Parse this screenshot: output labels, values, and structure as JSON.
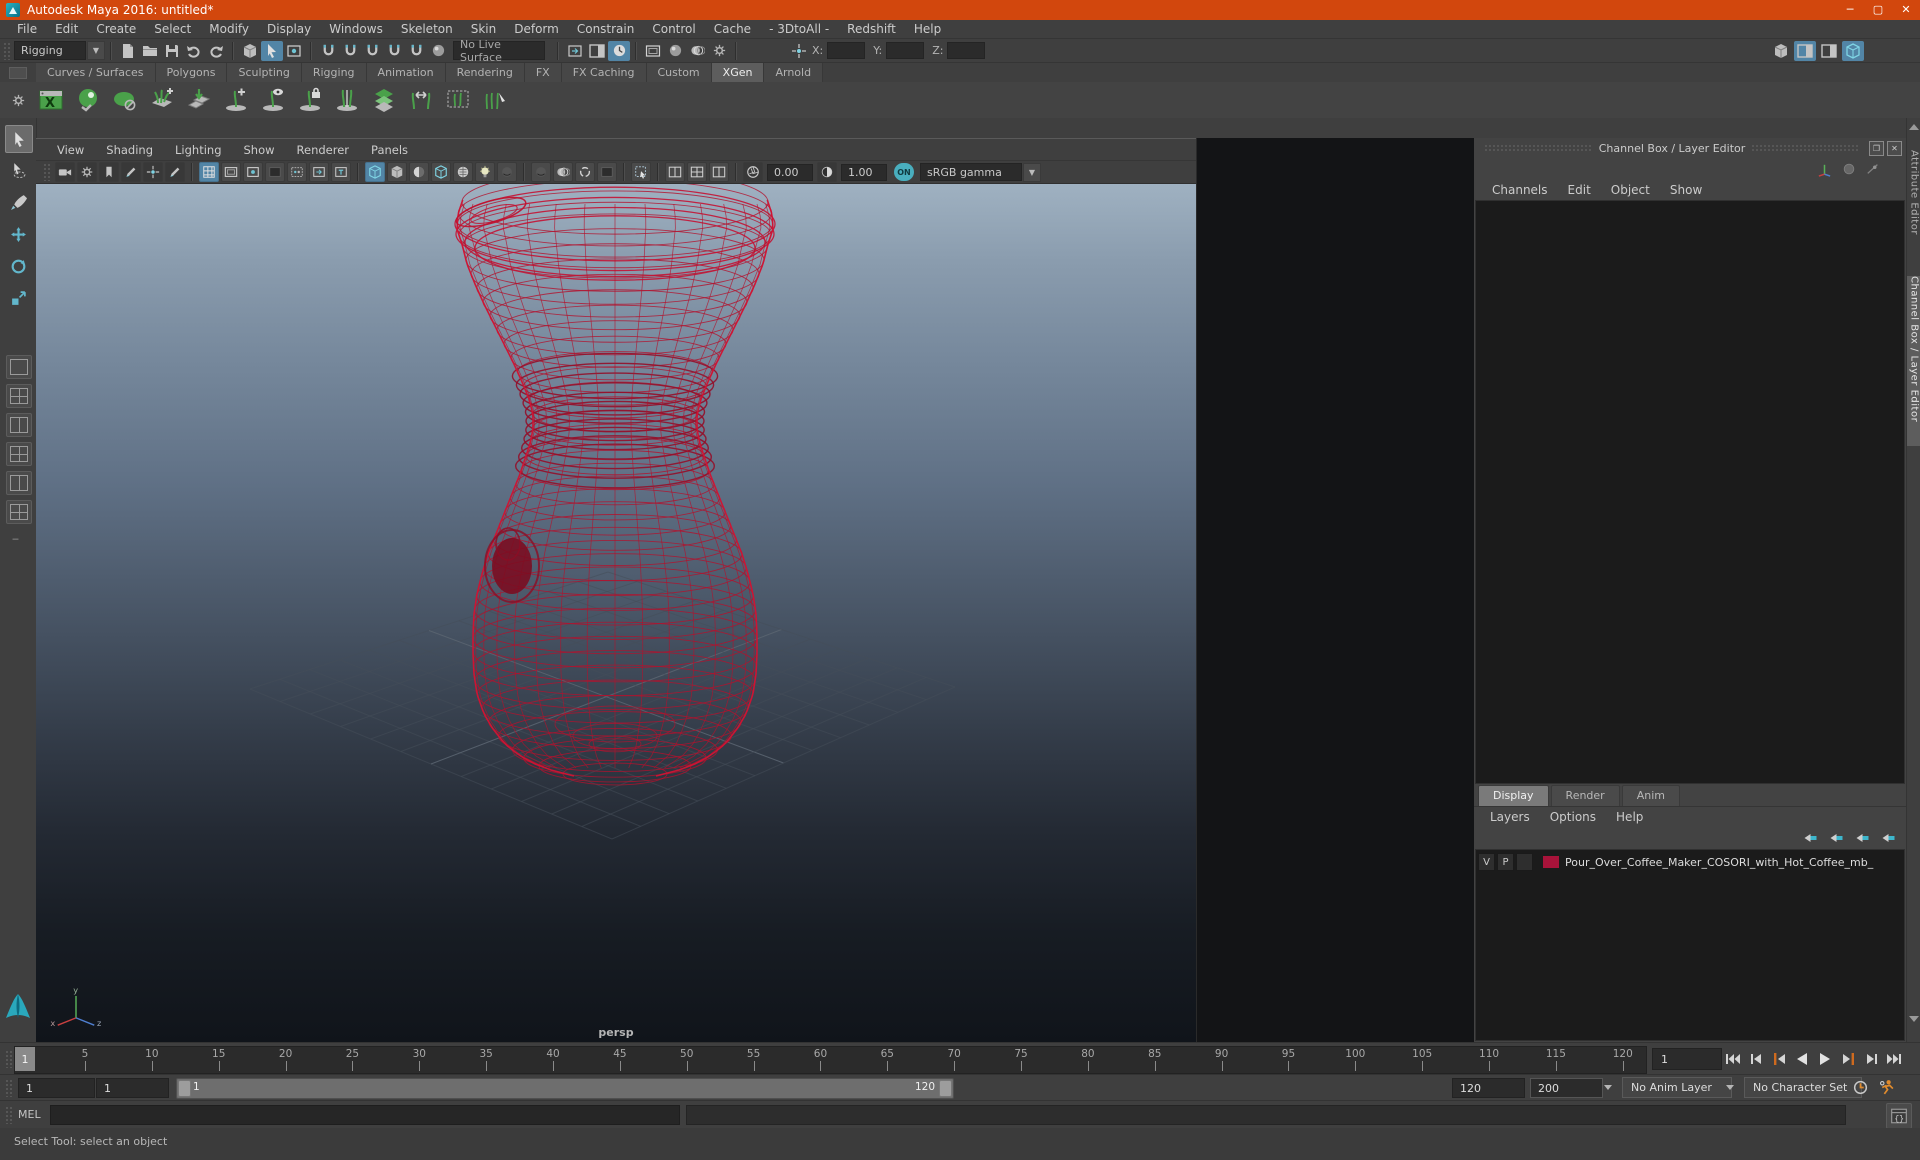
{
  "titlebar": {
    "title": "Autodesk Maya 2016: untitled*",
    "minimize": "─",
    "maximize": "▢",
    "close": "✕"
  },
  "menubar": {
    "items": [
      "File",
      "Edit",
      "Create",
      "Select",
      "Modify",
      "Display",
      "Windows",
      "Skeleton",
      "Skin",
      "Deform",
      "Constrain",
      "Control",
      "Cache",
      "- 3DtoAll -",
      "Redshift",
      "Help"
    ]
  },
  "toolbar": {
    "menu_set": "Rigging",
    "no_live_surface": "No Live Surface",
    "x_label": "X:",
    "y_label": "Y:",
    "z_label": "Z:"
  },
  "shelf": {
    "tabs": [
      "Curves / Surfaces",
      "Polygons",
      "Sculpting",
      "Rigging",
      "Animation",
      "Rendering",
      "FX",
      "FX Caching",
      "Custom",
      "XGen",
      "Arnold"
    ],
    "active": "XGen"
  },
  "viewport": {
    "menu": [
      "View",
      "Shading",
      "Lighting",
      "Show",
      "Renderer",
      "Panels"
    ],
    "exposure": "0.00",
    "contrast": "1.00",
    "on_label": "ON",
    "gamma": "sRGB gamma",
    "camera_label": "persp",
    "axis": {
      "x": "x",
      "y": "y",
      "z": "z"
    }
  },
  "channel_box": {
    "title": "Channel Box / Layer Editor",
    "menu": [
      "Channels",
      "Edit",
      "Object",
      "Show"
    ]
  },
  "layer_editor": {
    "tabs": [
      "Display",
      "Render",
      "Anim"
    ],
    "active_tab": "Display",
    "menu": [
      "Layers",
      "Options",
      "Help"
    ],
    "layer": {
      "visible": "V",
      "playback": "P",
      "name": "Pour_Over_Coffee_Maker_COSORI_with_Hot_Coffee_mb_",
      "swatch_color": "#a8133a"
    }
  },
  "right_strip": {
    "tabs": [
      "Attribute Editor",
      "Channel Box / Layer Editor"
    ],
    "active": "Channel Box / Layer Editor"
  },
  "time_slider": {
    "current_frame": "1",
    "ticks": [
      "5",
      "10",
      "15",
      "20",
      "25",
      "30",
      "35",
      "40",
      "45",
      "50",
      "55",
      "60",
      "65",
      "70",
      "75",
      "80",
      "85",
      "90",
      "95",
      "100",
      "105",
      "110",
      "115",
      "120"
    ],
    "frame_field": "1"
  },
  "range_slider": {
    "anim_start": "1",
    "play_start": "1",
    "range_min_label": "1",
    "range_max_label": "120",
    "play_end": "120",
    "anim_end": "200",
    "anim_layer": "No Anim Layer",
    "character_set": "No Character Set"
  },
  "command_line": {
    "label": "MEL"
  },
  "help_line": {
    "message": "Select Tool: select an object"
  },
  "colors": {
    "titlebar": "#d2470d",
    "accent_blue": "#5285a6",
    "accent_cyan": "#49aebe",
    "wireframe_red": "#b3122d",
    "shelf_green": "#58a758",
    "playback_orange": "#cf6a1e",
    "layer_swatch": "#a8133a"
  }
}
